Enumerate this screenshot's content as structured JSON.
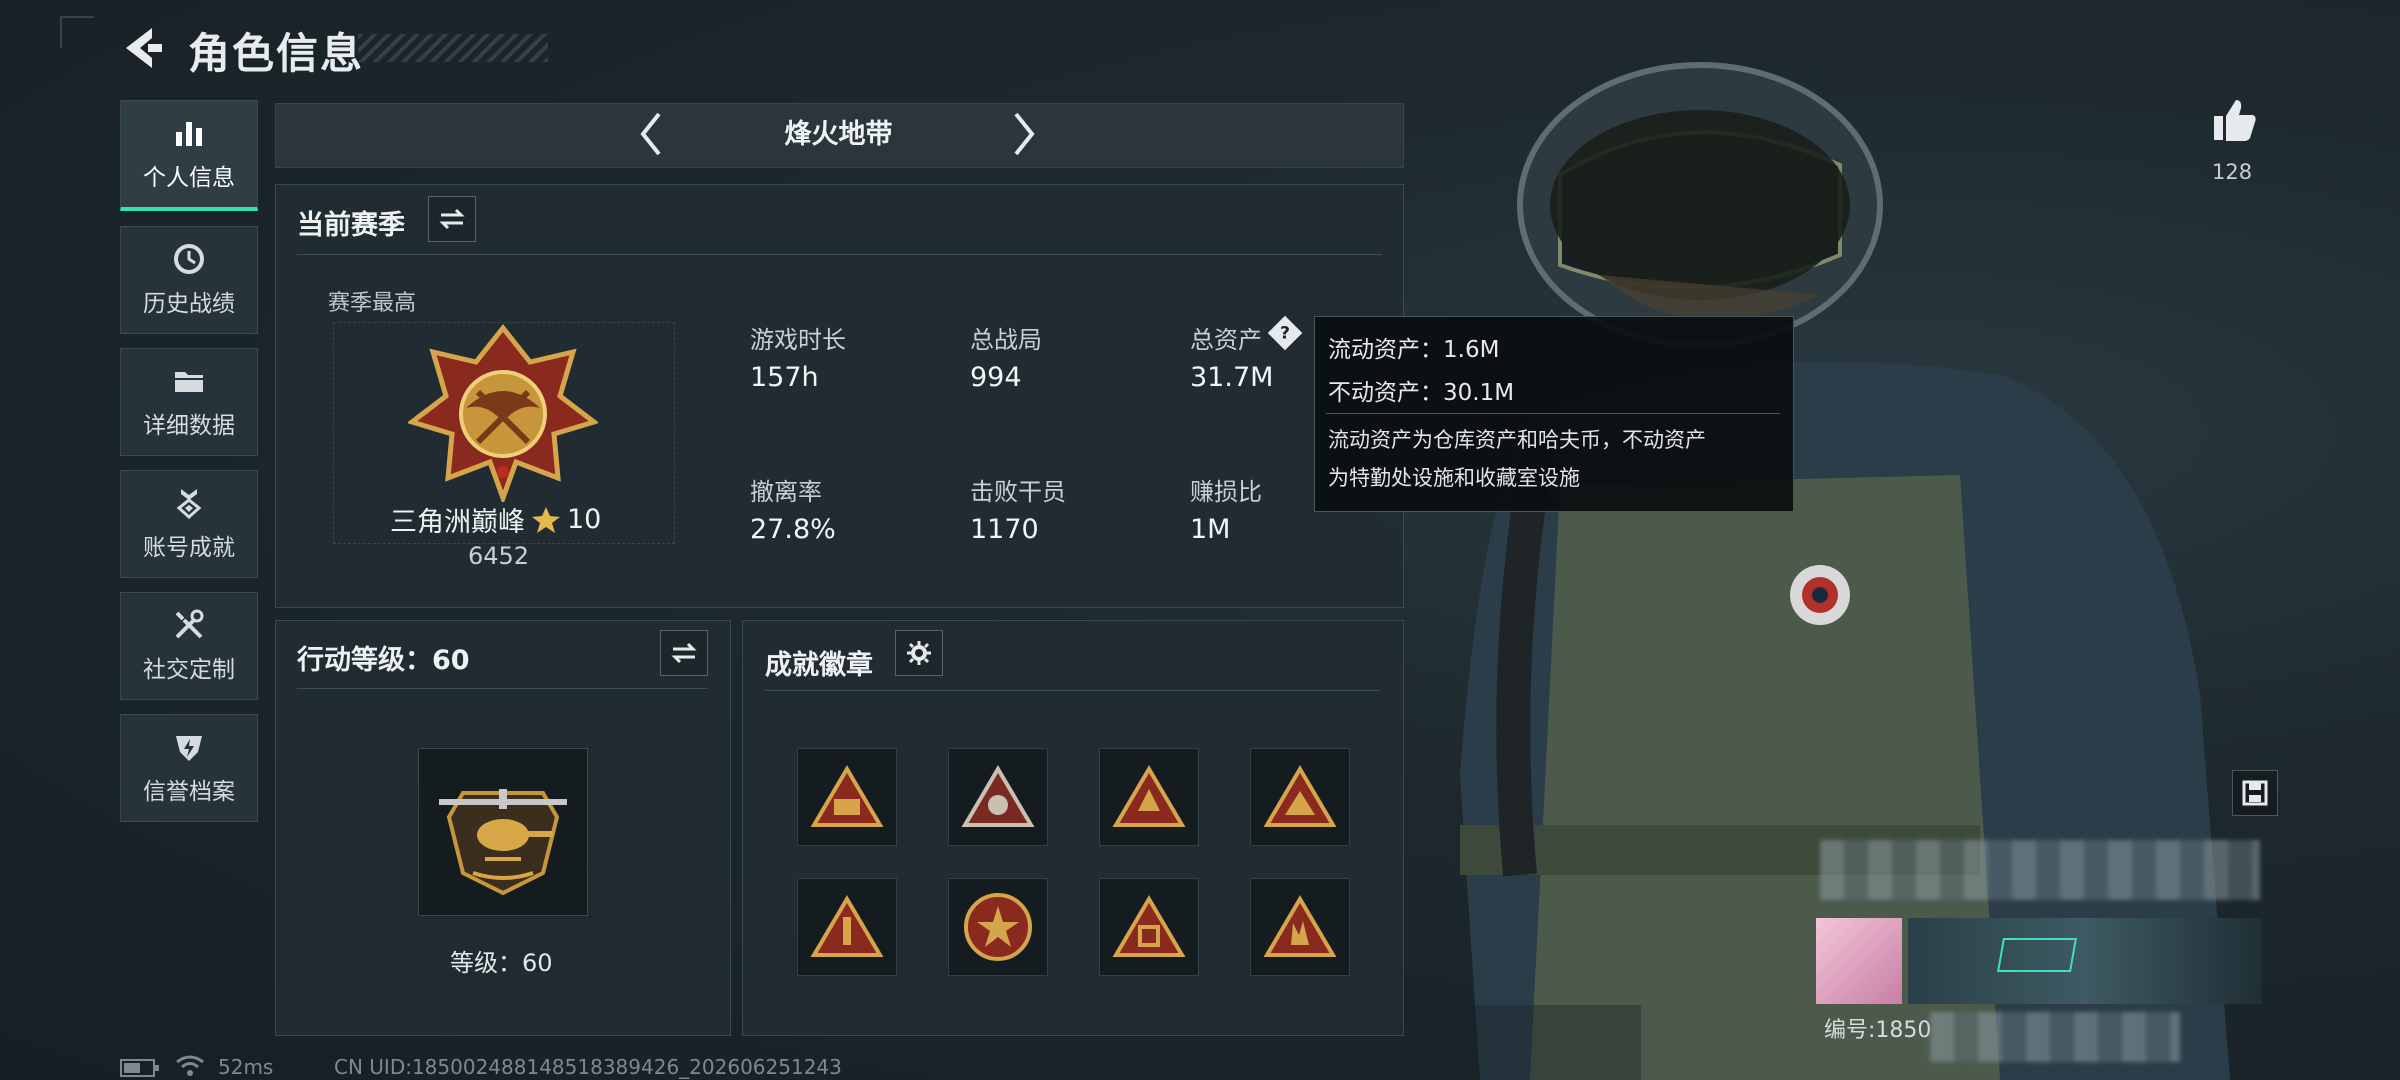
{
  "header": {
    "title": "角色信息"
  },
  "sidebar": {
    "items": [
      {
        "label": "个人信息",
        "icon": "bar-chart-icon",
        "active": true
      },
      {
        "label": "历史战绩",
        "icon": "clock-icon",
        "active": false
      },
      {
        "label": "详细数据",
        "icon": "folder-icon",
        "active": false
      },
      {
        "label": "账号成就",
        "icon": "medal-icon",
        "active": false
      },
      {
        "label": "社交定制",
        "icon": "tools-icon",
        "active": false
      },
      {
        "label": "信誉档案",
        "icon": "shield-icon",
        "active": false
      }
    ]
  },
  "mode": {
    "title": "烽火地带"
  },
  "season": {
    "title": "当前赛季",
    "best_label": "赛季最高",
    "rank_name": "三角洲巅峰",
    "rank_stars": "10",
    "rank_score": "6452",
    "stats": [
      {
        "label": "游戏时长",
        "value": "157h"
      },
      {
        "label": "总战局",
        "value": "994"
      },
      {
        "label": "总资产",
        "value": "31.7M"
      },
      {
        "label": "撤离率",
        "value": "27.8%"
      },
      {
        "label": "击败干员",
        "value": "1170"
      },
      {
        "label": "赚损比",
        "value": "1M"
      }
    ]
  },
  "tooltip": {
    "line1": "流动资产：1.6M",
    "line2": "不动资产：30.1M",
    "desc1": "流动资产为仓库资产和哈夫币，不动资产",
    "desc2": "为特勤处设施和收藏室设施"
  },
  "action_level": {
    "title": "行动等级：60",
    "level_text": "等级：60"
  },
  "achievements": {
    "title": "成就徽章"
  },
  "likes": {
    "count": "128"
  },
  "player": {
    "id_prefix": "编号:1850"
  },
  "status_bar": {
    "ping": "52ms",
    "uid": "CN UID:185002488148518389426_202606251243"
  },
  "colors": {
    "accent": "#2de3b6",
    "gold": "#c8963a",
    "bg": "#1a2429"
  }
}
